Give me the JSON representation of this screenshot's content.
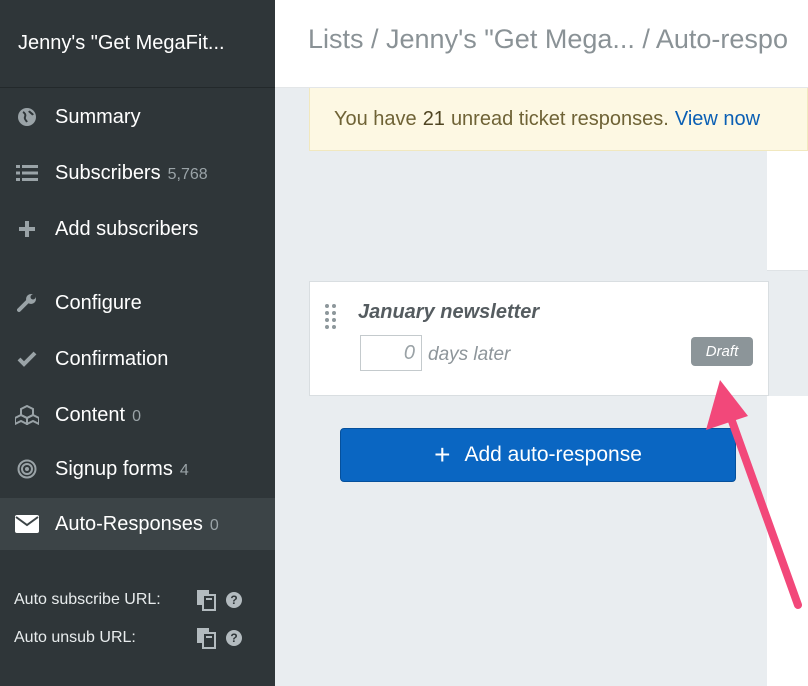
{
  "sidebar": {
    "title": "Jenny's \"Get MegaFit...",
    "items": [
      {
        "label": "Summary",
        "count": "",
        "icon": "globe-icon"
      },
      {
        "label": "Subscribers",
        "count": "5,768",
        "icon": "list-icon"
      },
      {
        "label": "Add subscribers",
        "count": "",
        "icon": "plus-icon"
      },
      {
        "label": "Configure",
        "count": "",
        "icon": "wrench-icon"
      },
      {
        "label": "Confirmation",
        "count": "",
        "icon": "check-icon"
      },
      {
        "label": "Content",
        "count": "0",
        "icon": "cubes-icon"
      },
      {
        "label": "Signup forms",
        "count": "4",
        "icon": "target-icon"
      },
      {
        "label": "Auto-Responses",
        "count": "0",
        "icon": "envelope-icon",
        "active": true
      }
    ],
    "auto_subscribe_label": "Auto subscribe URL:",
    "auto_unsub_label": "Auto unsub URL:"
  },
  "header": {
    "breadcrumb": "Lists / Jenny's \"Get Mega... / Auto-respo"
  },
  "notice": {
    "prefix": "You have",
    "count": "21",
    "suffix": "unread ticket responses.",
    "link": "View now"
  },
  "autoresponse": {
    "title": "January newsletter",
    "days_value": "0",
    "days_label": "days later",
    "status": "Draft"
  },
  "add_button": {
    "label": "Add auto-response"
  },
  "colors": {
    "sidebar_bg": "#2f3639",
    "primary": "#0a66c2",
    "annotation_arrow": "#f2487a"
  }
}
